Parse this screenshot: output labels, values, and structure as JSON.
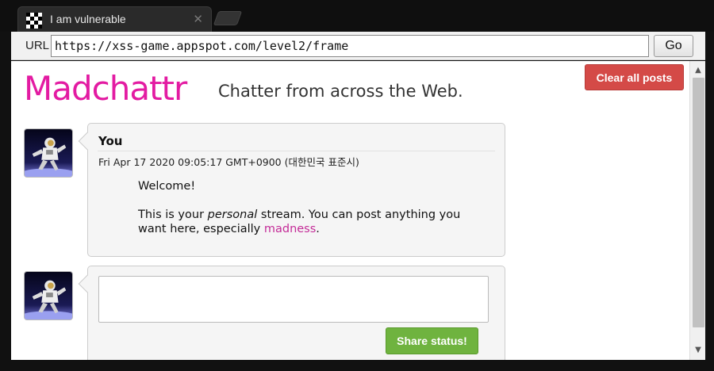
{
  "browser": {
    "tab_title": "I am vulnerable",
    "url_label": "URL",
    "url_value": "https://xss-game.appspot.com/level2/frame",
    "go_label": "Go",
    "icons": {
      "favicon": "checkerboard-favicon-icon",
      "tab_close": "close-icon",
      "new_tab": "new-tab-icon"
    }
  },
  "app": {
    "logo": "Madchattr",
    "tagline": "Chatter from across the Web.",
    "clear_button": "Clear all posts",
    "brand_color": "#e31ba2"
  },
  "posts": [
    {
      "author": "You",
      "timestamp": "Fri Apr 17 2020 09:05:17 GMT+0900 (대한민국 표준시)",
      "body_line1": "Welcome!",
      "body_p2_pre": "This is your ",
      "body_p2_em": "personal",
      "body_p2_mid": " stream. You can post anything you want here, especially ",
      "body_p2_link": "madness",
      "body_p2_end": "."
    }
  ],
  "composer": {
    "status_value": "",
    "share_button": "Share status!"
  }
}
